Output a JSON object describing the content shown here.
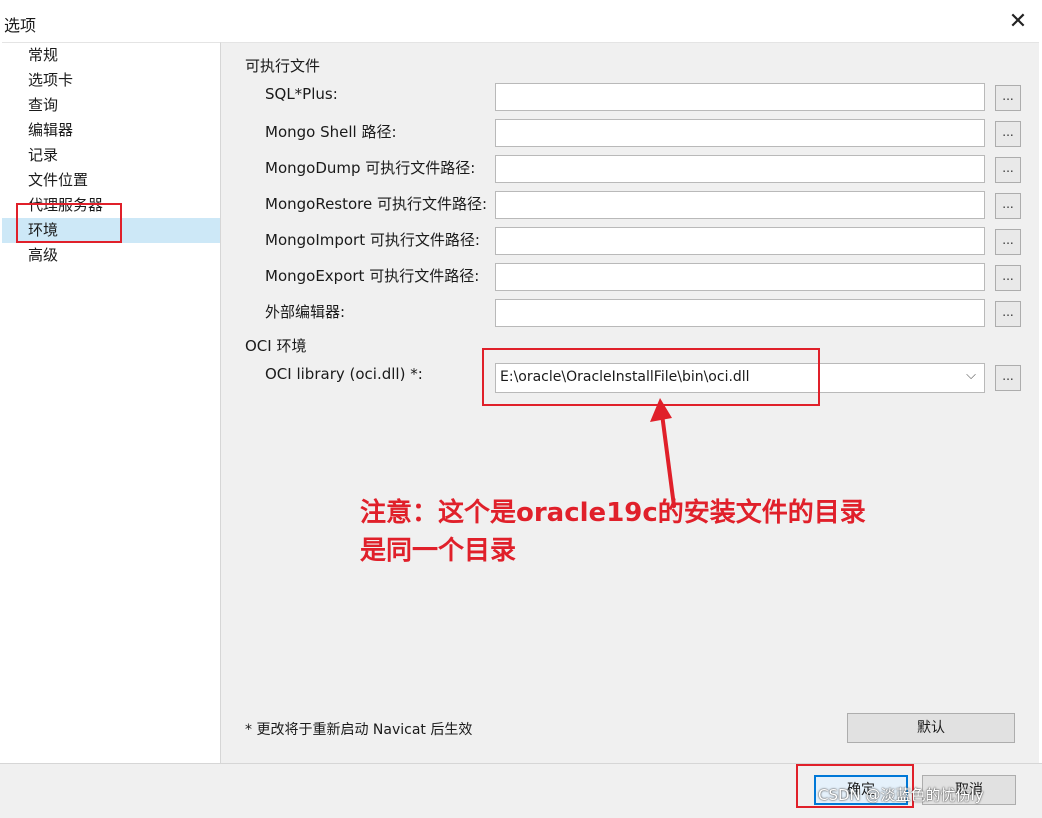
{
  "window": {
    "title": "选项",
    "close_glyph": "✕"
  },
  "sidebar": {
    "items": [
      {
        "label": "常规"
      },
      {
        "label": "选项卡"
      },
      {
        "label": "查询"
      },
      {
        "label": "编辑器"
      },
      {
        "label": "记录"
      },
      {
        "label": "文件位置"
      },
      {
        "label": "代理服务器"
      },
      {
        "label": "环境",
        "selected": true
      },
      {
        "label": "高级"
      }
    ]
  },
  "executables": {
    "section_title": "可执行文件",
    "fields": [
      {
        "label": "SQL*Plus:",
        "value": ""
      },
      {
        "label": "Mongo Shell 路径:",
        "value": ""
      },
      {
        "label": "MongoDump 可执行文件路径:",
        "value": ""
      },
      {
        "label": "MongoRestore 可执行文件路径:",
        "value": ""
      },
      {
        "label": "MongoImport 可执行文件路径:",
        "value": ""
      },
      {
        "label": "MongoExport 可执行文件路径:",
        "value": ""
      },
      {
        "label": "外部编辑器:",
        "value": ""
      }
    ],
    "browse_label": "..."
  },
  "oci": {
    "section_title": "OCI 环境",
    "library_label": "OCI library (oci.dll) *:",
    "library_value": "E:\\oracle\\OracleInstallFile\\bin\\oci.dll",
    "dropdown_glyph": "⌵",
    "browse_label": "..."
  },
  "footnote": "* 更改将于重新启动 Navicat 后生效",
  "buttons": {
    "default": "默认",
    "ok": "确定",
    "cancel": "取消"
  },
  "annotation": {
    "line1": "注意：这个是oracle19c的安装文件的目录",
    "line2": "是同一个目录",
    "color": "#e0202a"
  },
  "watermark": "CSDN @淡蓝色的忧伤ly"
}
